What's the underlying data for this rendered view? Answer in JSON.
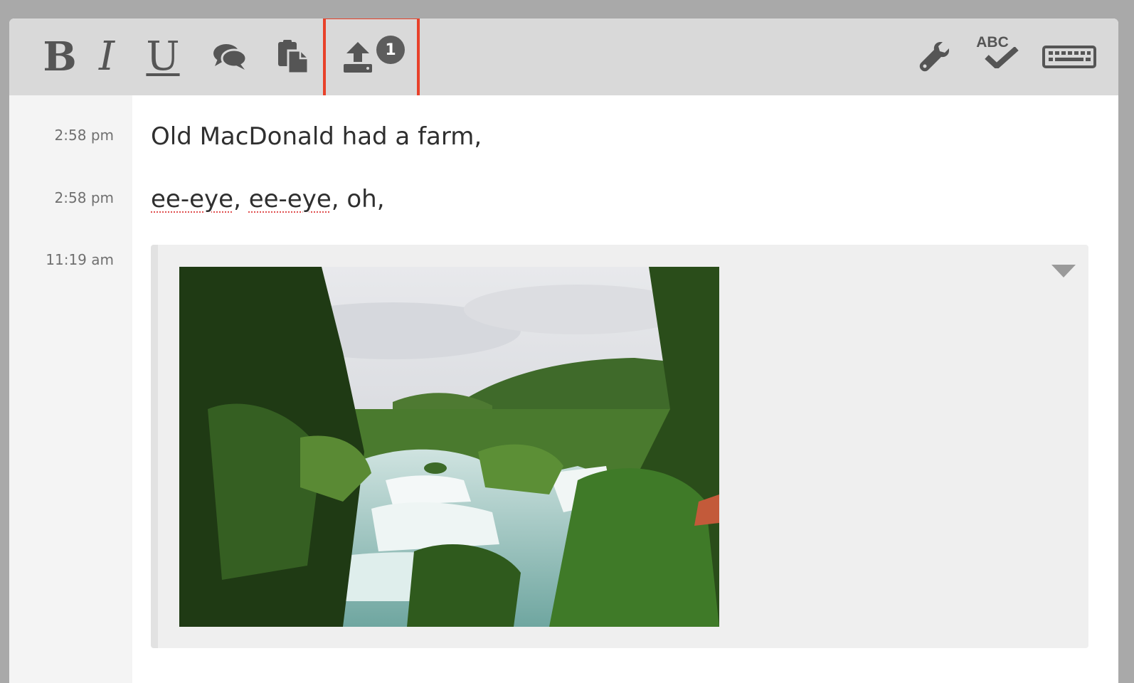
{
  "toolbar": {
    "bold_label": "B",
    "italic_label": "I",
    "underline_label": "U",
    "upload_badge_count": "1",
    "highlight_color": "#e8412a",
    "icons": [
      "comment-icon",
      "paste-icon",
      "upload-icon",
      "wrench-icon",
      "spellcheck-icon",
      "keyboard-icon"
    ],
    "spellcheck_label": "ABC"
  },
  "entries": [
    {
      "time": "2:58 pm",
      "text": "Old MacDonald had a farm,"
    },
    {
      "time": "2:58 pm",
      "text_parts": [
        "ee-eye",
        ", ",
        "ee-eye",
        ", oh,"
      ]
    },
    {
      "time": "11:19 am",
      "attachment": "image"
    }
  ]
}
